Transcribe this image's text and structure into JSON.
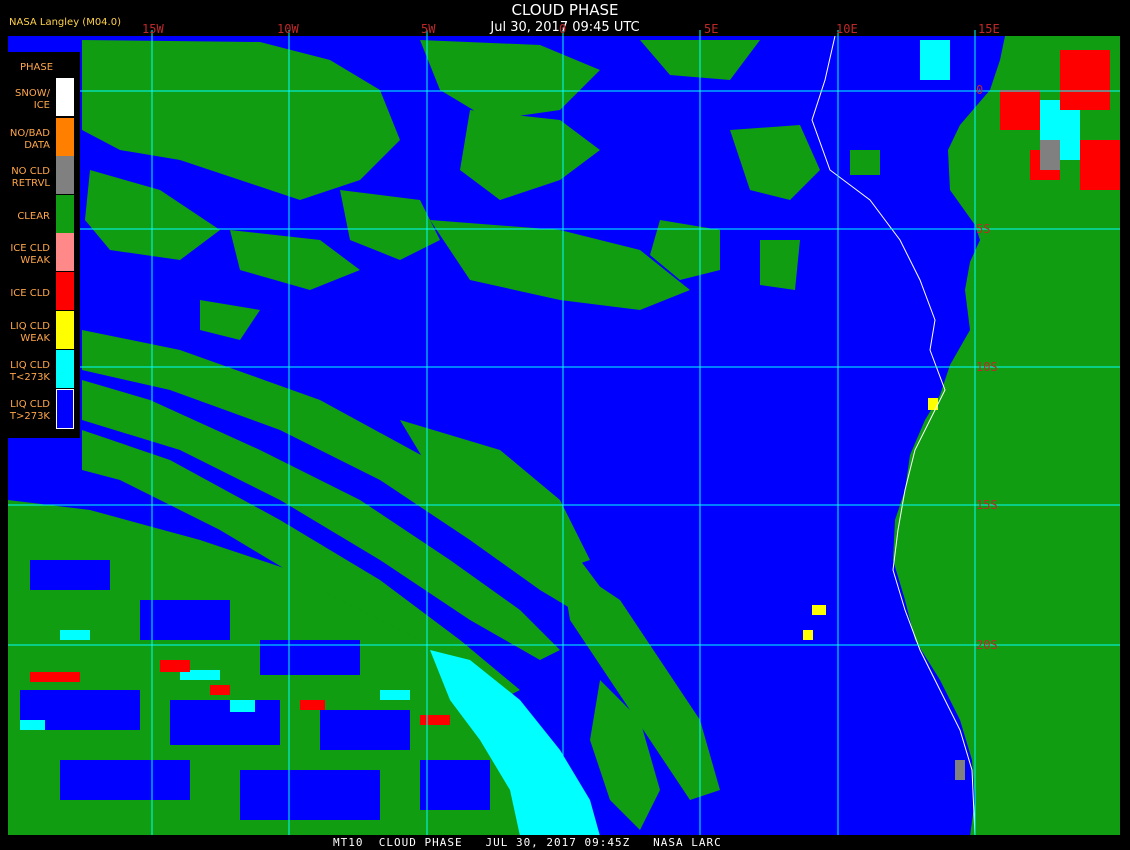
{
  "header": {
    "title": "CLOUD PHASE",
    "subtitle": "Jul 30, 2017 09:45 UTC",
    "credit": "NASA Langley (M04.0)"
  },
  "footer": {
    "text": "MT10  CLOUD PHASE   JUL 30, 2017 09:45Z   NASA LARC"
  },
  "grid": {
    "longitude_labels": [
      "15W",
      "10W",
      "5W",
      "0",
      "5E",
      "10E",
      "15E"
    ],
    "latitude_labels": [
      "0",
      "5S",
      "10S",
      "15S",
      "20S"
    ]
  },
  "legend": {
    "title": "PHASE",
    "items": [
      {
        "label": "SNOW/ ICE",
        "color": "#ffffff"
      },
      {
        "label": "NO/BAD DATA",
        "color": "#ff8000"
      },
      {
        "label": "NO CLD RETRVL",
        "color": "#808080"
      },
      {
        "label": "CLEAR",
        "color": "#119d11"
      },
      {
        "label": "ICE CLD WEAK",
        "color": "#ff8888"
      },
      {
        "label": "ICE CLD",
        "color": "#ff0000"
      },
      {
        "label": "LIQ CLD WEAK",
        "color": "#ffff00"
      },
      {
        "label": "LIQ CLD T<273K",
        "color": "#00ffff"
      },
      {
        "label": "LIQ CLD T>273K",
        "color": "#0000ff"
      }
    ]
  },
  "colors": {
    "ocean_liquid_cloud": "#0000ff",
    "clear": "#119d11",
    "grid": "#00ffff",
    "label": "#c0282a"
  }
}
